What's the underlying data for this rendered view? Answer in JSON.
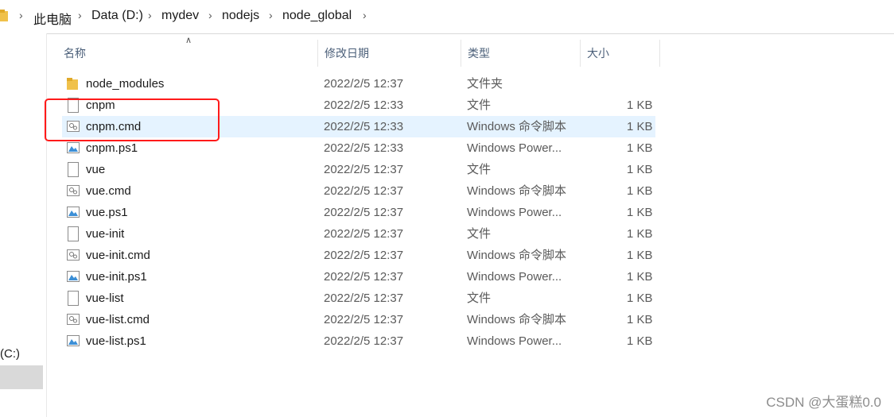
{
  "breadcrumb": [
    "此电脑",
    "Data (D:)",
    "mydev",
    "nodejs",
    "node_global"
  ],
  "columns": {
    "name": "名称",
    "date": "修改日期",
    "type": "类型",
    "size": "大小"
  },
  "nav": {
    "drive_label": "(C:)"
  },
  "files": [
    {
      "name": "node_modules",
      "date": "2022/2/5 12:37",
      "type": "文件夹",
      "size": "",
      "icon": "folder-icon"
    },
    {
      "name": "cnpm",
      "date": "2022/2/5 12:33",
      "type": "文件",
      "size": "1 KB",
      "icon": "file-icon"
    },
    {
      "name": "cnpm.cmd",
      "date": "2022/2/5 12:33",
      "type": "Windows 命令脚本",
      "size": "1 KB",
      "icon": "cmd-script-icon",
      "selected": true
    },
    {
      "name": "cnpm.ps1",
      "date": "2022/2/5 12:33",
      "type": "Windows Power...",
      "size": "1 KB",
      "icon": "powershell-script-icon"
    },
    {
      "name": "vue",
      "date": "2022/2/5 12:37",
      "type": "文件",
      "size": "1 KB",
      "icon": "file-icon"
    },
    {
      "name": "vue.cmd",
      "date": "2022/2/5 12:37",
      "type": "Windows 命令脚本",
      "size": "1 KB",
      "icon": "cmd-script-icon"
    },
    {
      "name": "vue.ps1",
      "date": "2022/2/5 12:37",
      "type": "Windows Power...",
      "size": "1 KB",
      "icon": "powershell-script-icon"
    },
    {
      "name": "vue-init",
      "date": "2022/2/5 12:37",
      "type": "文件",
      "size": "1 KB",
      "icon": "file-icon"
    },
    {
      "name": "vue-init.cmd",
      "date": "2022/2/5 12:37",
      "type": "Windows 命令脚本",
      "size": "1 KB",
      "icon": "cmd-script-icon"
    },
    {
      "name": "vue-init.ps1",
      "date": "2022/2/5 12:37",
      "type": "Windows Power...",
      "size": "1 KB",
      "icon": "powershell-script-icon"
    },
    {
      "name": "vue-list",
      "date": "2022/2/5 12:37",
      "type": "文件",
      "size": "1 KB",
      "icon": "file-icon"
    },
    {
      "name": "vue-list.cmd",
      "date": "2022/2/5 12:37",
      "type": "Windows 命令脚本",
      "size": "1 KB",
      "icon": "cmd-script-icon"
    },
    {
      "name": "vue-list.ps1",
      "date": "2022/2/5 12:37",
      "type": "Windows Power...",
      "size": "1 KB",
      "icon": "powershell-script-icon"
    }
  ],
  "watermark": "CSDN @大蛋糕0.0",
  "colors": {
    "selection": "#e5f3ff",
    "highlight_box": "#ff1a1a",
    "header_text": "#4c607a",
    "folder": "#f0c14b"
  }
}
